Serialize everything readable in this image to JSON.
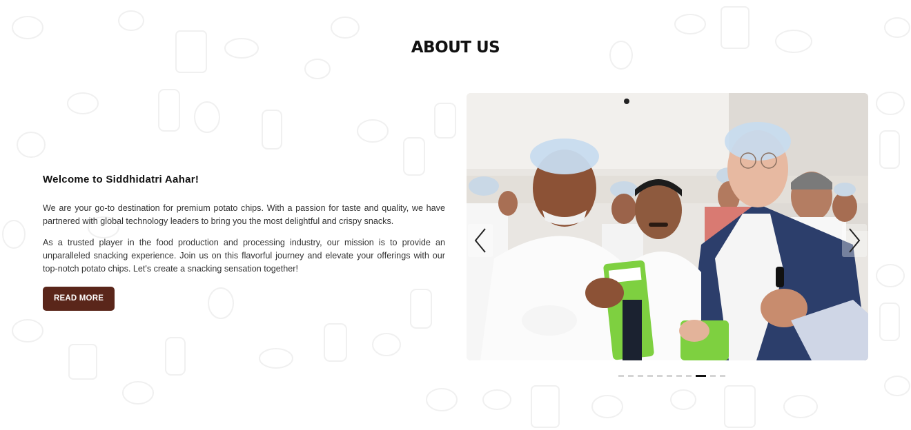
{
  "about": {
    "title": "ABOUT US",
    "welcome_heading": "Welcome to Siddhidatri Aahar!",
    "paragraphs": [
      "We are your go-to destination for premium potato chips. With a passion for taste and quality, we have partnered with global technology leaders to bring you the most delightful and crispy snacks.",
      "As a trusted player in the food production and processing industry, our mission is to provide an unparalleled snacking experience. Join us on this flavorful journey and elevate your offerings with our top-notch potato chips. Let's create a snacking sensation together!"
    ],
    "read_more_label": "READ MORE"
  },
  "carousel": {
    "slide_count": 11,
    "active_index": 8,
    "prev_icon": "chevron-left-icon",
    "next_icon": "chevron-right-icon"
  },
  "colors": {
    "button_bg": "#5a261a",
    "active_dot": "#111111",
    "inactive_dot": "#d4d4d4"
  }
}
